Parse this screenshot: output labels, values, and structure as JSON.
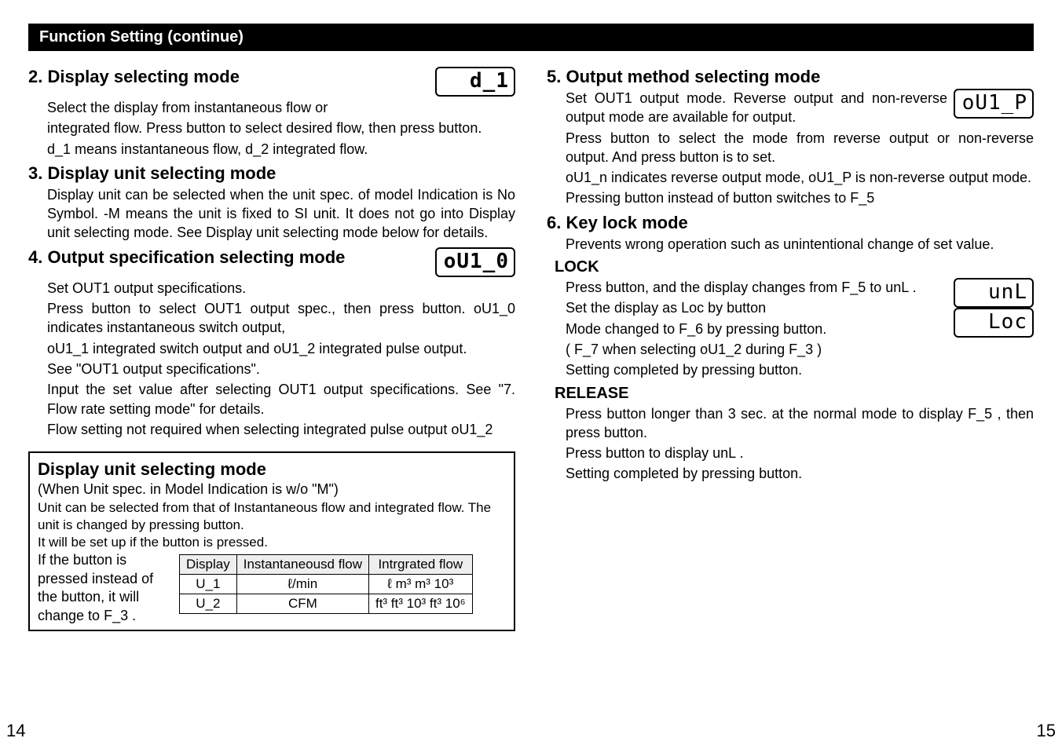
{
  "banner": "Function Setting (continue)",
  "left": {
    "s2": {
      "title": "2. Display selecting mode",
      "lcd": "d_1",
      "p1": "Select the display from instantaneous flow or",
      "p2": "integrated flow. Press     button to select desired flow, then press     button.",
      "p3": "d_1  means instantaneous flow,  d_2  integrated flow."
    },
    "s3": {
      "title": "3. Display unit selecting mode",
      "p1": "Display unit can be selected when the unit spec. of model Indication is No Symbol. -M means the unit is fixed to SI unit. It does not go into Display unit selecting mode. See  Display unit selecting mode  below for details."
    },
    "s4": {
      "title": "4. Output specification selecting mode",
      "lcd": "oU1_0",
      "p1": "Set OUT1 output specifications.",
      "p2": "Press    button to select OUT1 output spec., then press     button.  oU1_0  indicates instantaneous switch output,",
      "p3": " oU1_1  integrated switch output and  oU1_2  integrated pulse output.",
      "p4": "See \"OUT1 output specifications\".",
      "p5": "Input the set value after selecting OUT1 output specifications. See \"7. Flow rate setting mode\" for details.",
      "p6": "Flow setting not required when selecting integrated pulse output  oU1_2"
    },
    "box": {
      "title": "Display unit selecting mode",
      "sub": "(When Unit spec. in Model Indication is w/o \"M\")",
      "p1": "Unit can be selected from that of Instantaneous flow and integrated flow. The unit is changed by pressing     button.",
      "p2": "It will be set up if the       button is pressed.",
      "side": "If the       button is pressed instead of the       button, it will change to   F_3  .",
      "table": {
        "h1": "Display",
        "h2": "Instantaneousd flow",
        "h3": "Intrgrated flow",
        "r1c1": "U_1",
        "r1c2": "ℓ/min",
        "r1c3": "ℓ  m³  m³  10³",
        "r2c1": "U_2",
        "r2c2": "CFM",
        "r2c3": "ft³ ft³  10³ ft³  10⁶"
      }
    }
  },
  "right": {
    "s5": {
      "title": "5. Output method selecting mode",
      "lcd": "oU1_P",
      "p1": "Set OUT1 output mode. Reverse output and non-reverse output mode are available for output.",
      "p2": "Press    button to select the mode from reverse output or non-reverse output. And press        button is to set.",
      "p3": " oU1_n  indicates reverse output mode,  oU1_P  is non-reverse output mode.",
      "p4": "Pressing       button instead of       button switches to  F_5"
    },
    "s6": {
      "title": "6. Key lock mode",
      "p1": "Prevents wrong operation such as unintentional change of set value."
    },
    "lock": {
      "title": "LOCK",
      "lcd1": "unL",
      "lcd2": "Loc",
      "p1": "Press       button, and the display changes from  F_5  to  unL  .",
      "p2": "Set the display as   Loc   by     button",
      "p3": "Mode changed to   F_6   by pressing        button.",
      "p4": "(  F_7  when selecting  oU1_2  during  F_3  )",
      "p5": "Setting completed by pressing       button."
    },
    "release": {
      "title": "RELEASE",
      "p1": "Press        button longer than 3 sec. at the normal mode to display   F_5   , then press        button.",
      "p2": "Press    button to display   unL  .",
      "p3": "Setting completed by pressing        button."
    }
  },
  "page_left": "14",
  "page_right": "15"
}
